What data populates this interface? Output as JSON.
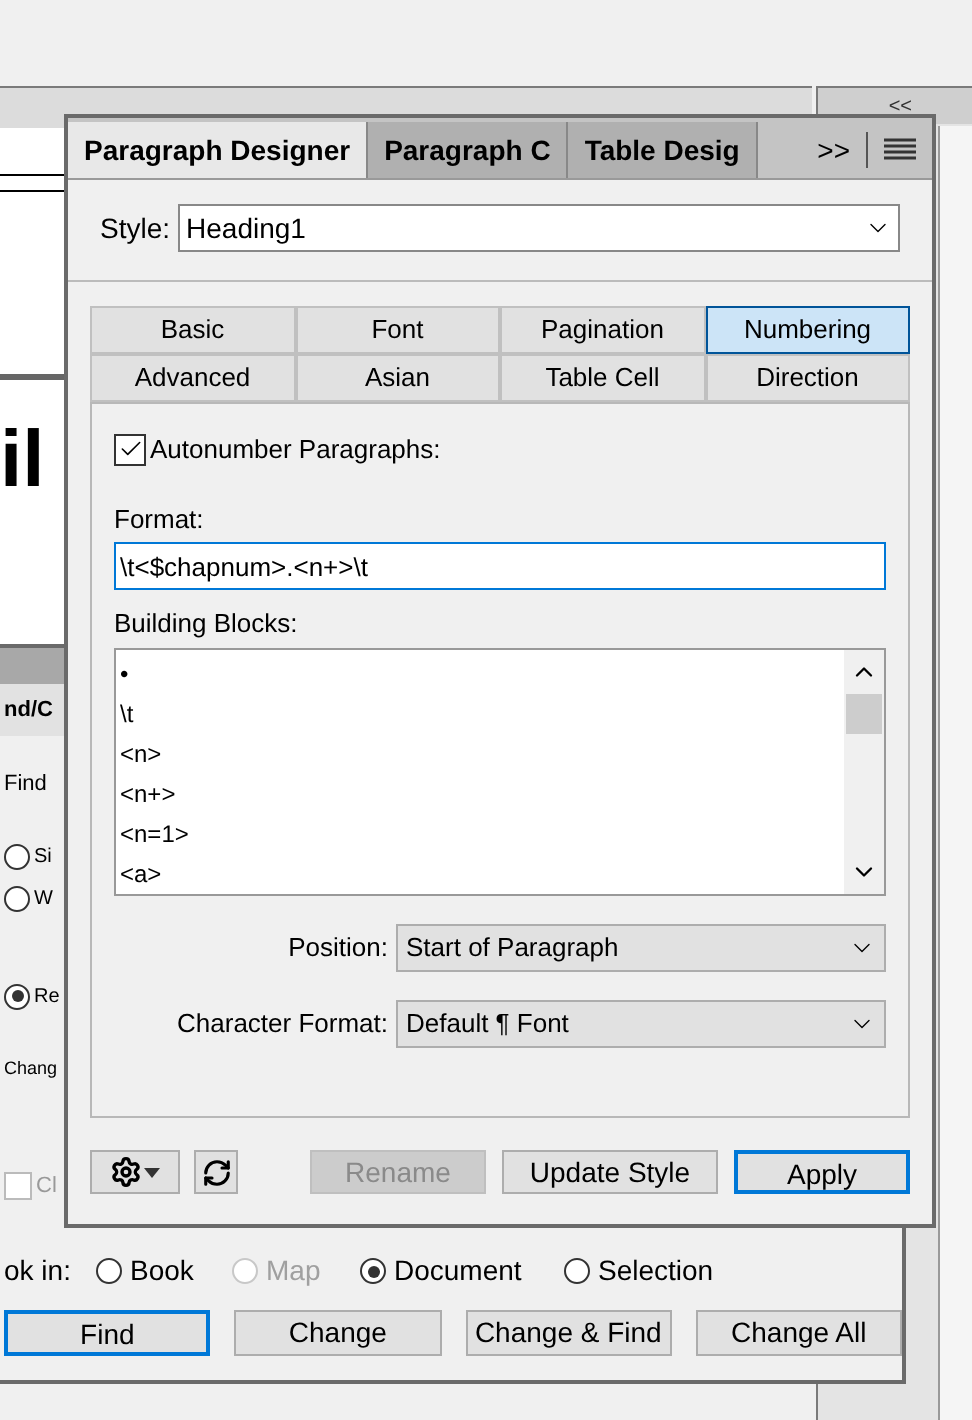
{
  "side_panel": {
    "collapse": "<<"
  },
  "document": {
    "text": "il"
  },
  "find_change": {
    "title": "nd/C",
    "find_label": "Find",
    "options": [
      {
        "label": "Si",
        "selected": false
      },
      {
        "label": "W",
        "selected": false
      },
      {
        "label": "Re",
        "selected": true
      }
    ],
    "change_label": "Chang",
    "checkbox": {
      "label": "Cl",
      "checked": false
    },
    "look_in": {
      "label": "ok in:",
      "options": [
        {
          "label": "Book",
          "selected": false,
          "disabled": false
        },
        {
          "label": "Map",
          "selected": false,
          "disabled": true
        },
        {
          "label": "Document",
          "selected": true,
          "disabled": false
        },
        {
          "label": "Selection",
          "selected": false,
          "disabled": false
        }
      ]
    },
    "buttons": [
      {
        "label": "Find",
        "default": true
      },
      {
        "label": "Change",
        "default": false
      },
      {
        "label": "Change & Find",
        "default": false
      },
      {
        "label": "Change All",
        "default": false
      }
    ]
  },
  "paragraph_designer": {
    "tabs": [
      {
        "label": "Paragraph Designer",
        "selected": true
      },
      {
        "label": "Paragraph C",
        "selected": false
      },
      {
        "label": "Table Desig",
        "selected": false
      }
    ],
    "overflow": ">>",
    "style": {
      "label": "Style:",
      "value": "Heading1"
    },
    "property_tabs": [
      {
        "label": "Basic",
        "selected": false
      },
      {
        "label": "Font",
        "selected": false
      },
      {
        "label": "Pagination",
        "selected": false
      },
      {
        "label": "Numbering",
        "selected": true
      },
      {
        "label": "Advanced",
        "selected": false
      },
      {
        "label": "Asian",
        "selected": false
      },
      {
        "label": "Table Cell",
        "selected": false
      },
      {
        "label": "Direction",
        "selected": false
      }
    ],
    "autonumber": {
      "label": "Autonumber Paragraphs:",
      "checked": true
    },
    "format": {
      "label": "Format:",
      "value": "\\t<$chapnum>.<n+>\\t"
    },
    "building_blocks": {
      "label": "Building Blocks:",
      "items": [
        "•",
        "\\t",
        "<n>",
        "<n+>",
        "<n=1>",
        "<a>"
      ]
    },
    "position": {
      "label": "Position:",
      "value": "Start of Paragraph"
    },
    "character_format": {
      "label": "Character Format:",
      "value": "Default ¶ Font"
    },
    "buttons": [
      {
        "label": "Rename",
        "disabled": true,
        "default": false
      },
      {
        "label": "Update Style",
        "disabled": false,
        "default": false
      },
      {
        "label": "Apply",
        "disabled": false,
        "default": true
      }
    ]
  }
}
